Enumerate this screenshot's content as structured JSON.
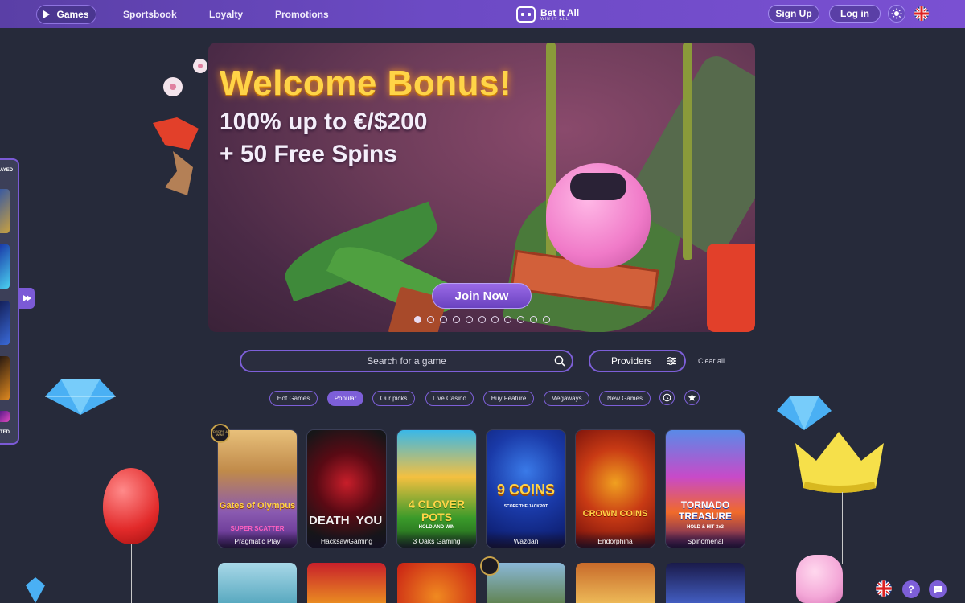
{
  "nav": {
    "games_label": "Games",
    "links": [
      "Sportsbook",
      "Loyalty",
      "Promotions"
    ],
    "logo_name": "Bet It All",
    "logo_tagline": "WIN IT ALL",
    "signup_label": "Sign Up",
    "login_label": "Log in",
    "theme_icon": "sun-icon",
    "language_icon": "uk-flag-icon"
  },
  "side_panel": {
    "top_label": "AYED",
    "bottom_label": "TED",
    "toggle_icon": "play-arrow-icon"
  },
  "banner": {
    "title": "Welcome Bonus!",
    "line1": "100% up to €/$200",
    "line2": "+ 50 Free Spins",
    "cta": "Join Now",
    "slides": 11,
    "active_slide": 0
  },
  "search": {
    "placeholder": "Search for a game",
    "providers_label": "Providers",
    "clear_label": "Clear all"
  },
  "categories": {
    "items": [
      "Hot Games",
      "Popular",
      "Our picks",
      "Live Casino",
      "Buy Feature",
      "Megaways",
      "New Games"
    ],
    "active": "Popular",
    "history_icon": "history-icon",
    "favorites_icon": "star-icon"
  },
  "games_row1": [
    {
      "title": "Gates of Olympus",
      "subtitle": "SUPER SCATTER",
      "provider": "Pragmatic Play",
      "badge": "DROPS & WINS"
    },
    {
      "title": "DEATH",
      "subtitle": "YOU",
      "provider": "HacksawGaming"
    },
    {
      "title": "4 CLOVER POTS",
      "subtitle": "HOLD AND WIN",
      "provider": "3 Oaks Gaming"
    },
    {
      "title": "9 COINS",
      "subtitle": "SCORE THE JACKPOT",
      "provider": "Wazdan"
    },
    {
      "title": "CROWN COINS",
      "subtitle": "",
      "provider": "Endorphina"
    },
    {
      "title": "TORNADO TREASURE",
      "subtitle": "HOLD & HIT 3x3",
      "provider": "Spinomenal"
    }
  ],
  "footer_actions": {
    "language_icon": "uk-flag-icon",
    "help_label": "?",
    "chat_icon": "chat-icon"
  }
}
